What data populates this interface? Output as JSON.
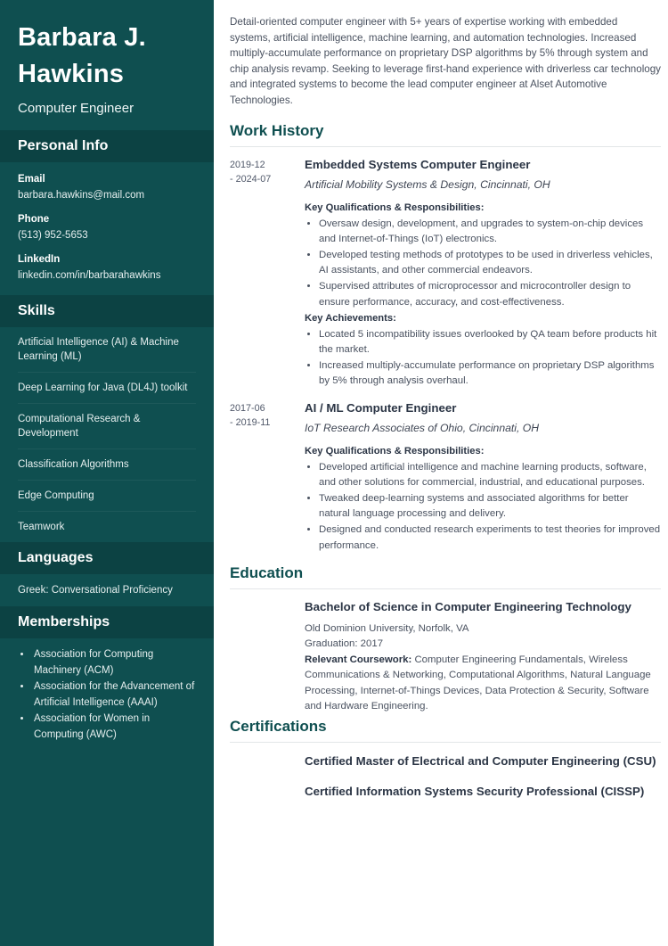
{
  "sidebar": {
    "name": "Barbara J. Hawkins",
    "role": "Computer Engineer",
    "personal_info": {
      "heading": "Personal Info",
      "items": [
        {
          "label": "Email",
          "value": "barbara.hawkins@mail.com"
        },
        {
          "label": "Phone",
          "value": "(513) 952-5653"
        },
        {
          "label": "LinkedIn",
          "value": "linkedin.com/in/barbarahawkins"
        }
      ]
    },
    "skills": {
      "heading": "Skills",
      "items": [
        "Artificial Intelligence (AI) & Machine Learning (ML)",
        "Deep Learning for Java (DL4J) toolkit",
        "Computational Research & Development",
        "Classification Algorithms",
        "Edge Computing",
        "Teamwork"
      ]
    },
    "languages": {
      "heading": "Languages",
      "items": [
        "Greek: Conversational Proficiency"
      ]
    },
    "memberships": {
      "heading": "Memberships",
      "items": [
        "Association for Computing Machinery (ACM)",
        "Association for the Advancement of Artificial Intelligence (AAAI)",
        "Association for Women in Computing (AWC)"
      ]
    }
  },
  "main": {
    "summary": "Detail-oriented computer engineer with 5+ years of expertise working with embedded systems, artificial intelligence, machine learning, and automation technologies. Increased multiply-accumulate performance on proprietary DSP algorithms by 5% through system and chip analysis revamp. Seeking to leverage first-hand experience with driverless car technology and integrated systems to become the lead computer engineer at Alset Automotive Technologies.",
    "work_history": {
      "heading": "Work History",
      "entries": [
        {
          "date_start": "2019-12",
          "date_end": "- 2024-07",
          "title": "Embedded Systems Computer Engineer",
          "employer": "Artificial Mobility Systems & Design, Cincinnati, OH",
          "qualifications_heading": "Key Qualifications & Responsibilities:",
          "qualifications": [
            "Oversaw design, development, and upgrades to system-on-chip devices and Internet-of-Things (IoT) electronics.",
            "Developed testing methods of prototypes to be used in driverless vehicles, AI assistants, and other commercial endeavors.",
            "Supervised attributes of microprocessor and microcontroller design to ensure performance, accuracy, and cost-effectiveness."
          ],
          "achievements_heading": "Key Achievements:",
          "achievements": [
            "Located 5 incompatibility issues overlooked by QA team before products hit the market.",
            "Increased multiply-accumulate performance on proprietary DSP algorithms by 5% through analysis overhaul."
          ]
        },
        {
          "date_start": "2017-06",
          "date_end": "- 2019-11",
          "title": "AI / ML Computer Engineer",
          "employer": "IoT Research Associates of Ohio, Cincinnati, OH",
          "qualifications_heading": "Key Qualifications & Responsibilities:",
          "qualifications": [
            "Developed artificial intelligence and machine learning products, software, and other solutions for commercial, industrial, and educational purposes.",
            "Tweaked deep-learning systems and associated algorithms for better natural language processing and delivery.",
            "Designed and conducted research experiments to test theories for improved performance."
          ],
          "achievements_heading": "",
          "achievements": []
        }
      ]
    },
    "education": {
      "heading": "Education",
      "degree": "Bachelor of Science in Computer Engineering Technology",
      "school": "Old Dominion University, Norfolk, VA",
      "graduation": "Graduation: 2017",
      "coursework_label": "Relevant Coursework:",
      "coursework": " Computer Engineering Fundamentals, Wireless Communications & Networking, Computational Algorithms, Natural Language Processing, Internet-of-Things Devices, Data Protection & Security, Software and Hardware Engineering."
    },
    "certifications": {
      "heading": "Certifications",
      "items": [
        "Certified Master of Electrical and Computer Engineering (CSU)",
        "Certified Information Systems Security Professional (CISSP)"
      ]
    }
  },
  "colors": {
    "sidebar_bg": "#0f4f50",
    "sidebar_head_bg": "#0c4243",
    "accent": "#0f4f50",
    "title_text": "#2b3545",
    "body_text": "#4a5260"
  }
}
